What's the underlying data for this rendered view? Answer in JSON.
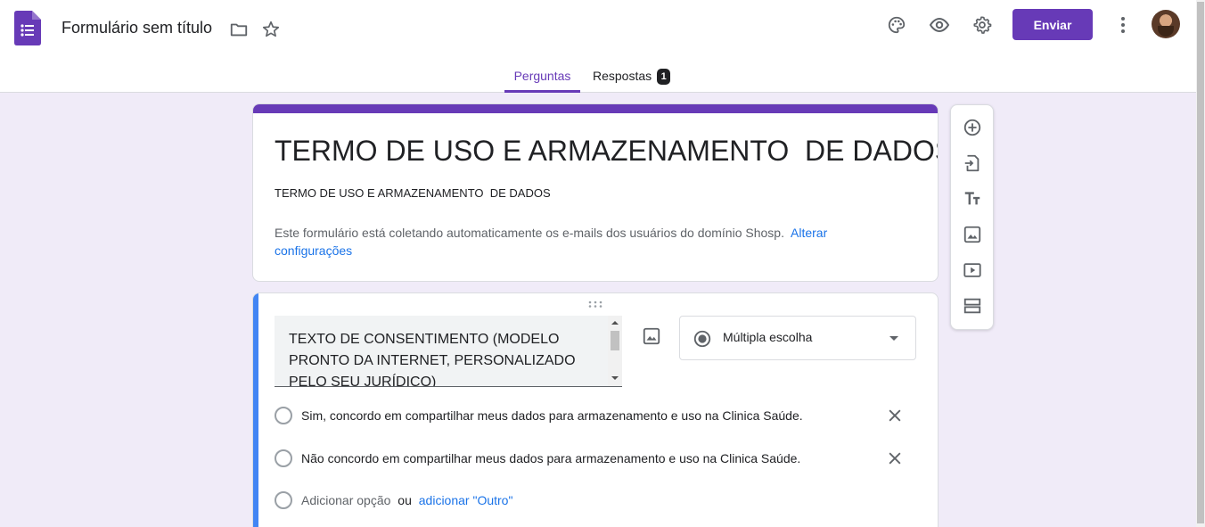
{
  "colors": {
    "accent": "#673ab7",
    "background": "#f0ebf8",
    "question_bar": "#4285f4",
    "link": "#1a73e8"
  },
  "header": {
    "title": "Formulário sem título",
    "send_label": "Enviar",
    "icons": [
      "folder-icon",
      "star-icon",
      "palette-icon",
      "eye-icon",
      "settings-icon",
      "more-vert-icon"
    ]
  },
  "tabs": [
    {
      "label": "Perguntas",
      "active": true
    },
    {
      "label": "Respostas",
      "badge": "1",
      "active": false
    }
  ],
  "form": {
    "title": "TERMO DE USO E ARMAZENAMENTO  DE DADOS",
    "description": "TERMO DE USO E ARMAZENAMENTO  DE DADOS",
    "email_notice": "Este formulário está coletando automaticamente os e-mails dos usuários do domínio Shosp.",
    "email_notice_link": "Alterar configurações"
  },
  "question": {
    "text": "TEXTO DE CONSENTIMENTO (MODELO PRONTO DA INTERNET, PERSONALIZADO PELO SEU JURÍDICO)",
    "type": "Múltipla escolha",
    "options": [
      "Sim, concordo em compartilhar meus dados para armazenamento e uso na Clinica Saúde.",
      "Não concordo em compartilhar meus dados para armazenamento e uso na Clinica Saúde."
    ],
    "add_option": "Adicionar opção",
    "or": "ou",
    "add_other": "adicionar \"Outro\""
  },
  "sidebar": {
    "icons": [
      "add-question-icon",
      "import-questions-icon",
      "add-title-icon",
      "add-image-icon",
      "add-video-icon",
      "add-section-icon"
    ]
  }
}
